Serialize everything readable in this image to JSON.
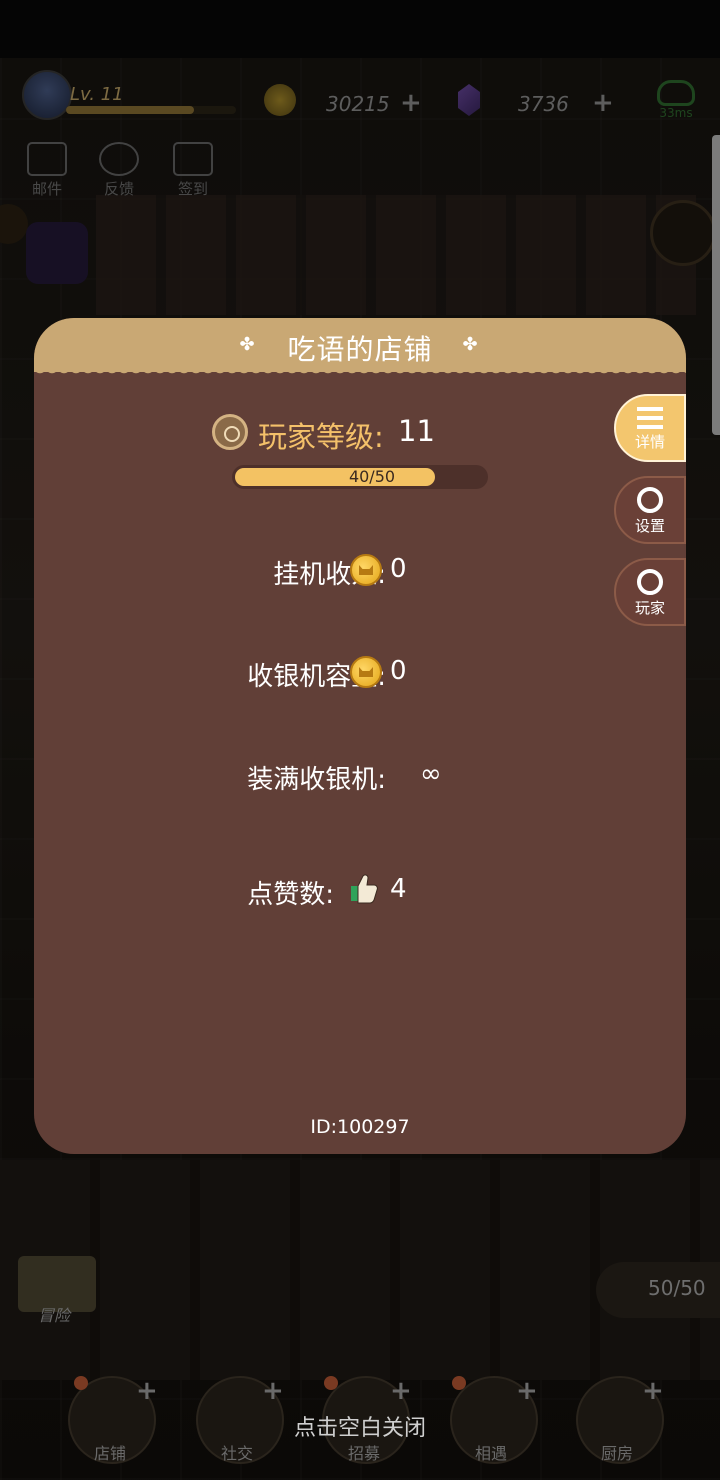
{
  "hud": {
    "level": "Lv. 11",
    "gold": "30215",
    "gems": "3736",
    "ping": "33ms",
    "shortcuts": [
      "邮件",
      "反馈",
      "签到"
    ]
  },
  "modal": {
    "title": "吃语的店铺",
    "player_level_label": "玩家等级:",
    "player_level": "11",
    "level_progress_text": "40/50",
    "level_progress_fraction": 0.8,
    "rows": {
      "idle_income_label": "挂机收入:",
      "idle_income_value": "0",
      "register_capacity_label": "收银机容量:",
      "register_capacity_value": "0",
      "fill_register_label": "装满收银机:",
      "fill_register_value": "∞",
      "likes_label": "点赞数:",
      "likes_value": "4"
    },
    "id_text": "ID:100297",
    "tabs": [
      "详情",
      "设置",
      "玩家"
    ]
  },
  "bottom": {
    "energy": "50/50",
    "adventure": "冒险",
    "nav": [
      "店铺",
      "社交",
      "招募",
      "相遇",
      "厨房"
    ],
    "close_hint": "点击空白关闭"
  }
}
